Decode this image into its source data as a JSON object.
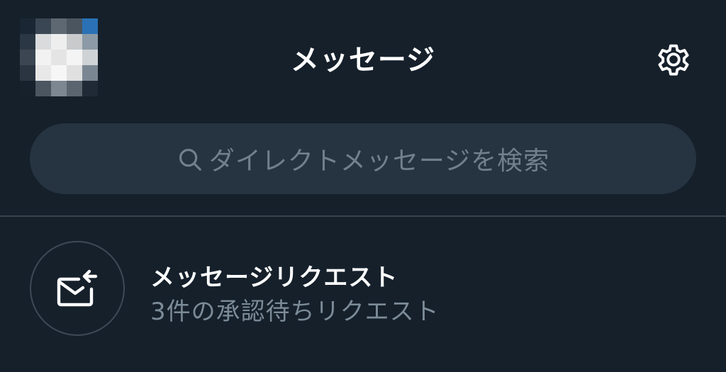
{
  "header": {
    "title": "メッセージ",
    "settings_icon": "gear-icon",
    "avatar_icon": "pixelated-avatar"
  },
  "search": {
    "icon": "search-icon",
    "placeholder": "ダイレクトメッセージを検索"
  },
  "message_requests": {
    "icon": "mail-incoming-icon",
    "title": "メッセージリクエスト",
    "subtitle": "3件の承認待ちリクエスト"
  },
  "colors": {
    "background": "#15202b",
    "search_background": "#263340",
    "muted_text": "#7c8b98",
    "divider": "#38444d"
  }
}
